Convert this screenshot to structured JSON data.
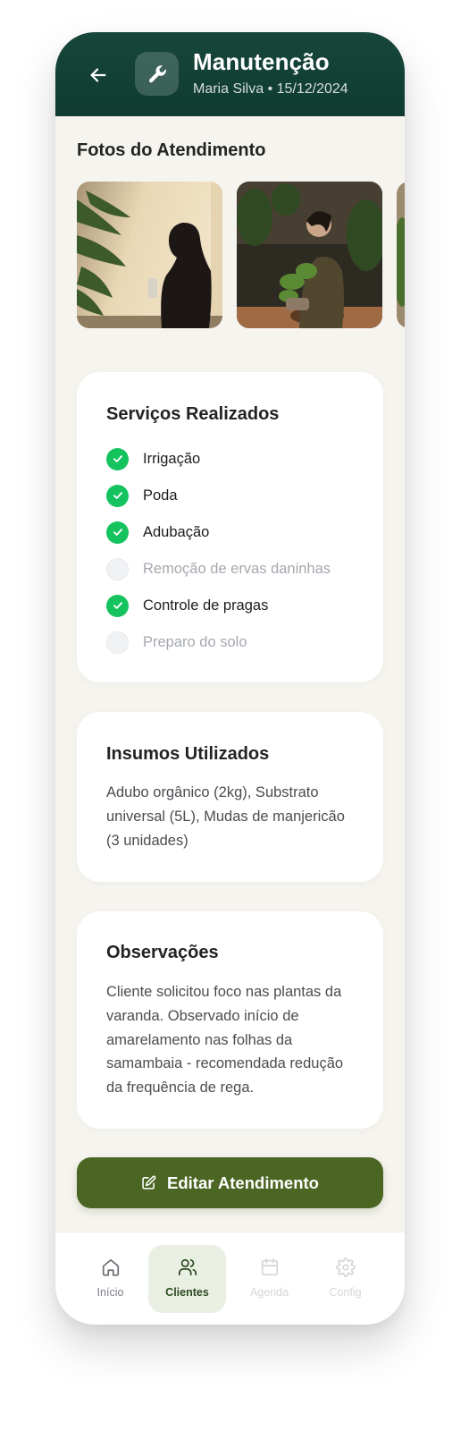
{
  "header": {
    "title": "Manutenção",
    "subtitle": "Maria Silva • 15/12/2024",
    "back_icon": "arrow-left-icon",
    "service_icon": "wrench-icon"
  },
  "photos": {
    "title": "Fotos do Atendimento",
    "items": [
      "photo-woman-spraying-plants",
      "photo-woman-repotting-plant",
      "photo-plants-partial"
    ]
  },
  "services": {
    "title": "Serviços Realizados",
    "items": [
      {
        "label": "Irrigação",
        "done": true
      },
      {
        "label": "Poda",
        "done": true
      },
      {
        "label": "Adubação",
        "done": true
      },
      {
        "label": "Remoção de ervas daninhas",
        "done": false
      },
      {
        "label": "Controle de pragas",
        "done": true
      },
      {
        "label": "Preparo do solo",
        "done": false
      }
    ]
  },
  "supplies": {
    "title": "Insumos Utilizados",
    "text": "Adubo orgânico (2kg), Substrato universal (5L), Mudas de manjericão (3 unidades)"
  },
  "notes": {
    "title": "Observações",
    "text": "Cliente solicitou foco nas plantas da varanda. Observado início de amarelamento nas folhas da samambaia - recomendada redução da frequência de rega."
  },
  "actions": {
    "edit_label": "Editar Atendimento",
    "edit_icon": "edit-icon"
  },
  "nav": {
    "items": [
      {
        "label": "Início",
        "icon": "home-icon",
        "active": false
      },
      {
        "label": "Clientes",
        "icon": "users-icon",
        "active": true
      },
      {
        "label": "Agenda",
        "icon": "calendar-icon",
        "active": false
      },
      {
        "label": "Config",
        "icon": "gear-icon",
        "active": false
      }
    ]
  },
  "colors": {
    "header": "#0f3b30",
    "check": "#14c25e",
    "button": "#4b6623",
    "nav_active_bg": "#e9f0e3",
    "nav_active_text": "#2d4a22",
    "nav_inactive_text": "#d4d6d9"
  }
}
